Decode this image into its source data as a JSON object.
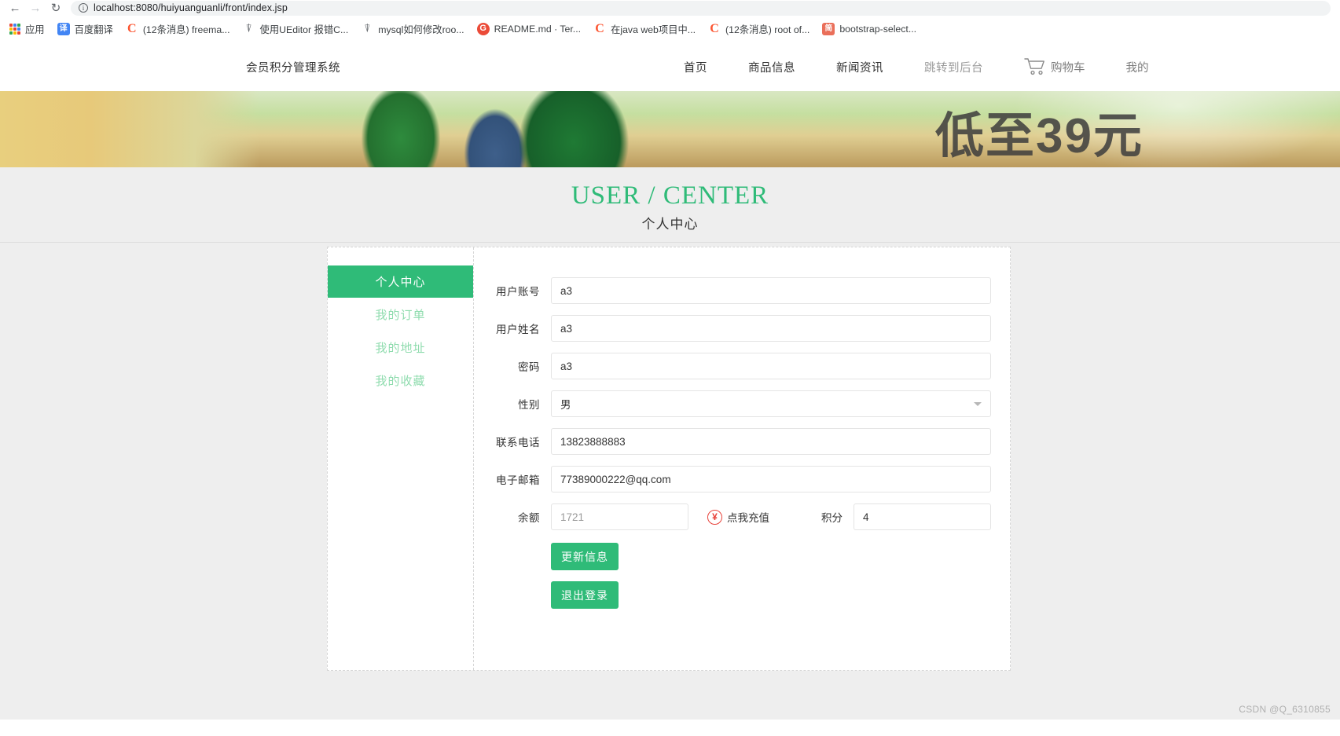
{
  "browser": {
    "back_icon": "back-arrow-icon",
    "forward_icon": "forward-arrow-icon",
    "reload_icon": "reload-icon",
    "site_info_icon": "info-circle-icon",
    "url": "localhost:8080/huiyuanguanli/front/index.jsp",
    "url_host": "localhost:8080",
    "url_path": "/huiyuanguanli/front/index.jsp",
    "bookmarks": [
      {
        "label": "应用",
        "icon": "apps-grid-icon"
      },
      {
        "label": "百度翻译",
        "icon": "translate-icon"
      },
      {
        "label": "(12条消息) freema...",
        "icon": "csdn-icon"
      },
      {
        "label": "使用UEditor 报错C...",
        "icon": "mysql-dolphin-icon"
      },
      {
        "label": "mysql如何修改roo...",
        "icon": "mysql-dolphin-icon"
      },
      {
        "label": "README.md · Ter...",
        "icon": "gitee-icon"
      },
      {
        "label": "在java web项目中...",
        "icon": "csdn-icon"
      },
      {
        "label": "(12条消息) root of...",
        "icon": "csdn-icon"
      },
      {
        "label": "bootstrap-select...",
        "icon": "jianshu-icon"
      }
    ]
  },
  "site": {
    "brand": "会员积分管理系统",
    "nav": [
      {
        "label": "首页",
        "muted": false
      },
      {
        "label": "商品信息",
        "muted": false
      },
      {
        "label": "新闻资讯",
        "muted": false
      },
      {
        "label": "跳转到后台",
        "muted": true
      }
    ],
    "cart": {
      "icon": "shopping-cart-icon",
      "label": "购物车"
    },
    "mine": {
      "label": "我的"
    },
    "banner": {
      "text": "低至39元"
    }
  },
  "page": {
    "title_en": "USER / CENTER",
    "title_cn": "个人中心"
  },
  "sidebar": {
    "items": [
      {
        "label": "个人中心",
        "active": true
      },
      {
        "label": "我的订单",
        "active": false
      },
      {
        "label": "我的地址",
        "active": false
      },
      {
        "label": "我的收藏",
        "active": false
      }
    ]
  },
  "form": {
    "fields": [
      {
        "label": "用户账号",
        "value": "a3",
        "type": "text"
      },
      {
        "label": "用户姓名",
        "value": "a3",
        "type": "text"
      },
      {
        "label": "密码",
        "value": "a3",
        "type": "text"
      },
      {
        "label": "性别",
        "value": "男",
        "type": "select"
      },
      {
        "label": "联系电话",
        "value": "13823888883",
        "type": "text"
      },
      {
        "label": "电子邮箱",
        "value": "77389000222@qq.com",
        "type": "text"
      }
    ],
    "balance": {
      "label": "余额",
      "value": "1721"
    },
    "recharge": {
      "icon": "yen-circle-icon",
      "label": "点我充值"
    },
    "points": {
      "label": "积分",
      "value": "4"
    },
    "buttons": [
      {
        "label": "更新信息",
        "name": "update-info-button"
      },
      {
        "label": "退出登录",
        "name": "logout-button"
      }
    ]
  },
  "watermark": "CSDN @Q_6310855",
  "colors": {
    "accent_green": "#2fbb78",
    "muted_green": "#8fdcae",
    "page_bg": "#eeeeee",
    "recharge_red": "#e8423a"
  }
}
